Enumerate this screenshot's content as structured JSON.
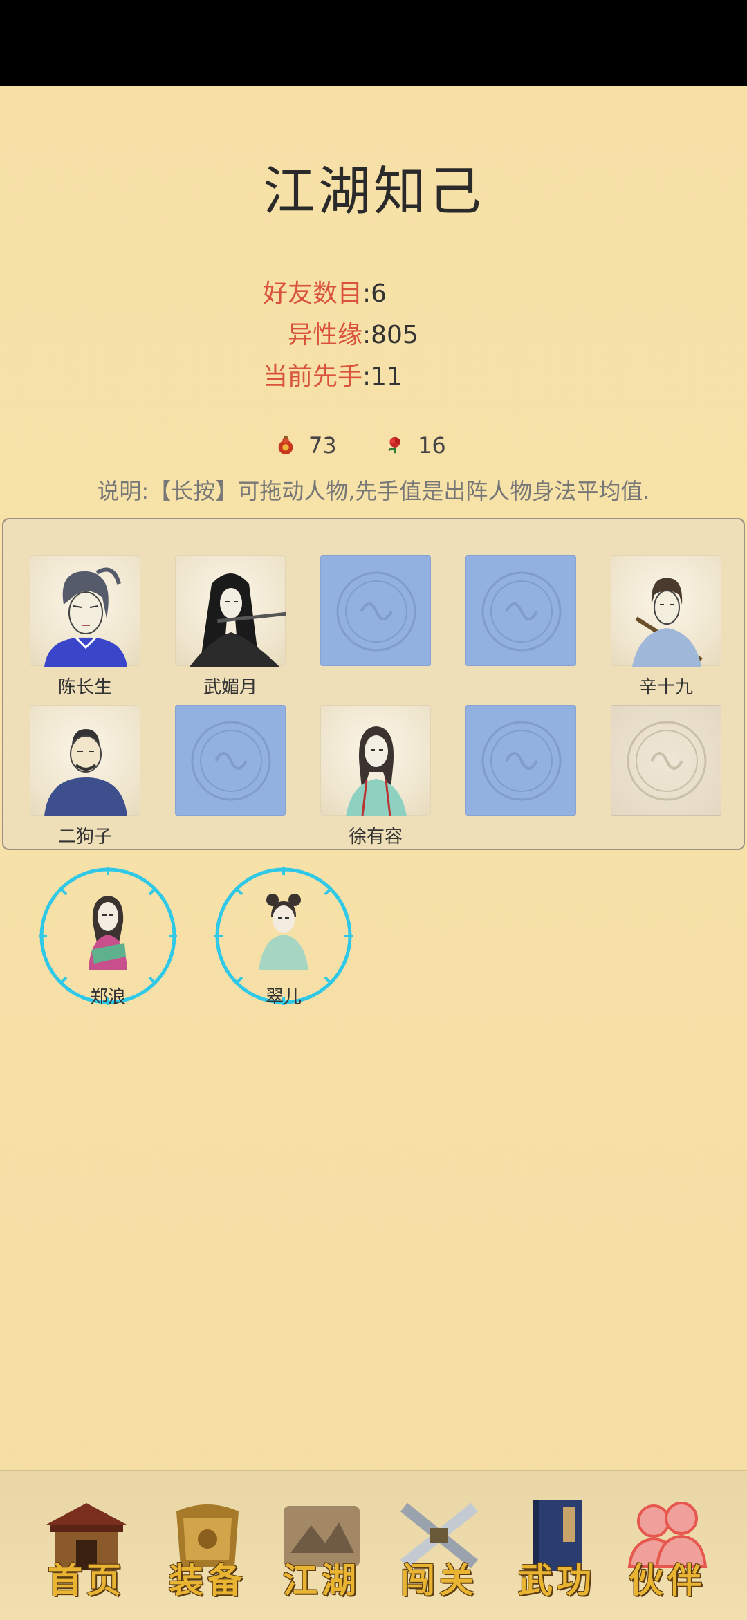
{
  "page": {
    "title": "江湖知己"
  },
  "stats": {
    "friends_label": "好友数目",
    "friends_value": ":6",
    "charm_label": "异性缘",
    "charm_value": ":805",
    "initiative_label": "当前先手",
    "initiative_value": ":11"
  },
  "resources": {
    "gourd": {
      "icon": "gourd-icon",
      "value": "73"
    },
    "rose": {
      "icon": "rose-icon",
      "value": "16"
    }
  },
  "note": "说明:【长按】可拖动人物,先手值是出阵人物身法平均值.",
  "grid": {
    "slots": [
      {
        "type": "character",
        "name": "陈长生",
        "icon": "chen-changsheng-portrait"
      },
      {
        "type": "character",
        "name": "武媚月",
        "icon": "wu-meiyue-portrait"
      },
      {
        "type": "empty",
        "name": ""
      },
      {
        "type": "empty",
        "name": ""
      },
      {
        "type": "character",
        "name": "辛十九",
        "icon": "xin-shijiu-portrait"
      },
      {
        "type": "character",
        "name": "二狗子",
        "icon": "er-gouzi-portrait"
      },
      {
        "type": "empty",
        "name": ""
      },
      {
        "type": "character",
        "name": "徐有容",
        "icon": "xu-yourong-portrait"
      },
      {
        "type": "empty",
        "name": ""
      },
      {
        "type": "locked",
        "name": ""
      }
    ]
  },
  "reserve": [
    {
      "name": "郑浪",
      "icon": "zheng-lang-portrait"
    },
    {
      "name": "翠儿",
      "icon": "cui-er-portrait"
    }
  ],
  "nav": [
    {
      "label": "首页",
      "icon": "home-house-icon"
    },
    {
      "label": "装备",
      "icon": "armor-icon"
    },
    {
      "label": "江湖",
      "icon": "scroll-map-icon"
    },
    {
      "label": "闯关",
      "icon": "crossed-swords-icon"
    },
    {
      "label": "武功",
      "icon": "martial-book-icon"
    },
    {
      "label": "伙伴",
      "icon": "companions-icon",
      "active": true
    }
  ],
  "colors": {
    "background": "#f6e0a6",
    "label_red": "#d9533b",
    "empty_slot": "#93b1e0",
    "ring_cyan": "#2fc8e6",
    "nav_gold": "#e8b431"
  }
}
